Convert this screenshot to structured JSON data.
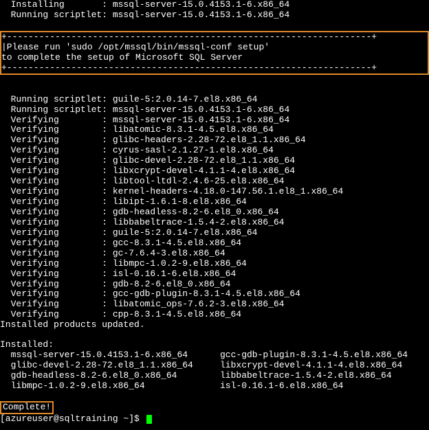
{
  "top": {
    "line1": "  Installing       : mssql-server-15.0.4153.1-6.x86_64",
    "line2": "  Running scriptlet: mssql-server-15.0.4153.1-6.x86_64"
  },
  "notice": {
    "border": "+--------------------------------------------------------------------+",
    "line1": "|Please run 'sudo /opt/mssql/bin/mssql-conf setup'",
    "line2": "to complete the setup of Microsoft SQL Server",
    "border2": "+--------------------------------------------------------------------+"
  },
  "verify": [
    "  Running scriptlet: guile-5:2.0.14-7.el8.x86_64",
    "  Running scriptlet: mssql-server-15.0.4153.1-6.x86_64",
    "  Verifying        : mssql-server-15.0.4153.1-6.x86_64",
    "  Verifying        : libatomic-8.3.1-4.5.el8.x86_64",
    "  Verifying        : glibc-headers-2.28-72.el8_1.1.x86_64",
    "  Verifying        : cyrus-sasl-2.1.27-1.el8.x86_64",
    "  Verifying        : glibc-devel-2.28-72.el8_1.1.x86_64",
    "  Verifying        : libxcrypt-devel-4.1.1-4.el8.x86_64",
    "  Verifying        : libtool-ltdl-2.4.6-25.el8.x86_64",
    "  Verifying        : kernel-headers-4.18.0-147.56.1.el8_1.x86_64",
    "  Verifying        : libipt-1.6.1-8.el8.x86_64",
    "  Verifying        : gdb-headless-8.2-6.el8_0.x86_64",
    "  Verifying        : libbabeltrace-1.5.4-2.el8.x86_64",
    "  Verifying        : guile-5:2.0.14-7.el8.x86_64",
    "  Verifying        : gcc-8.3.1-4.5.el8.x86_64",
    "  Verifying        : gc-7.6.4-3.el8.x86_64",
    "  Verifying        : libmpc-1.0.2-9.el8.x86_64",
    "  Verifying        : isl-0.16.1-6.el8.x86_64",
    "  Verifying        : gdb-8.2-6.el8_0.x86_64",
    "  Verifying        : gcc-gdb-plugin-8.3.1-4.5.el8.x86_64",
    "  Verifying        : libatomic_ops-7.6.2-3.el8.x86_64",
    "  Verifying        : cpp-8.3.1-4.5.el8.x86_64"
  ],
  "updated": "Installed products updated.",
  "installedHeader": "Installed:",
  "installedLeft": [
    "  mssql-server-15.0.4153.1-6.x86_64",
    "  glibc-devel-2.28-72.el8_1.1.x86_64",
    "  gdb-headless-8.2-6.el8_0.x86_64",
    "  libmpc-1.0.2-9.el8.x86_64"
  ],
  "installedRight": [
    "gcc-gdb-plugin-8.3.1-4.5.el8.x86_64",
    "libxcrypt-devel-4.1.1-4.el8.x86_64",
    "libbabeltrace-1.5.4-2.el8.x86_64",
    "isl-0.16.1-6.el8.x86_64"
  ],
  "complete": "Complete!",
  "prompt": "[azureuser@sqltraining ~]$ "
}
